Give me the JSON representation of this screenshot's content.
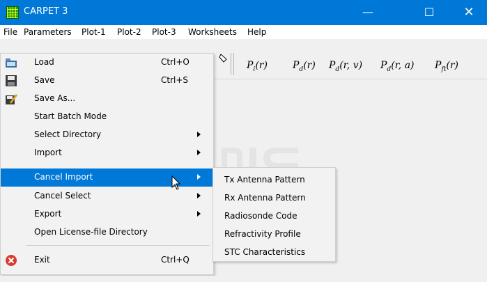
{
  "window": {
    "title": "CARPET 3",
    "minimize_glyph": "—",
    "maximize_glyph": "☐",
    "close_glyph": "✕"
  },
  "menubar": [
    "File",
    "Parameters",
    "Plot-1",
    "Plot-2",
    "Plot-3",
    "Worksheets",
    "Help"
  ],
  "toolbar": {
    "formulas": [
      {
        "base": "P",
        "sub": "i",
        "arg": "(r)"
      },
      {
        "base": "P",
        "sub": "d",
        "arg": "(r)"
      },
      {
        "base": "P",
        "sub": "d",
        "arg": "(r, v)"
      },
      {
        "base": "P",
        "sub": "d",
        "arg": "(r, a)"
      },
      {
        "base": "P",
        "sub": "ft",
        "arg": "(r)"
      }
    ]
  },
  "file_menu": {
    "items": [
      {
        "label": "Load",
        "shortcut": "Ctrl+O",
        "icon": "folder-open-icon"
      },
      {
        "label": "Save",
        "shortcut": "Ctrl+S",
        "icon": "floppy-disk-icon"
      },
      {
        "label": "Save As...",
        "shortcut": "",
        "icon": "save-as-pen-icon"
      },
      {
        "label": "Start Batch Mode",
        "shortcut": ""
      },
      {
        "label": "Select Directory",
        "shortcut": "",
        "submenu": true
      },
      {
        "label": "Import",
        "shortcut": "",
        "submenu": true
      },
      {
        "label": "Cancel Import",
        "shortcut": "",
        "submenu": true,
        "active": true
      },
      {
        "label": "Cancel Select",
        "shortcut": "",
        "submenu": true
      },
      {
        "label": "Export",
        "shortcut": "",
        "submenu": true
      },
      {
        "label": "Open License-file Directory",
        "shortcut": ""
      },
      {
        "label": "Exit",
        "shortcut": "Ctrl+Q",
        "icon": "exit-icon"
      }
    ]
  },
  "submenu": {
    "items": [
      "Tx Antenna Pattern",
      "Rx Antenna Pattern",
      "Radiosonde Code",
      "Refractivity Profile",
      "STC Characteristics"
    ]
  },
  "colors": {
    "titlebar": "#0078d7",
    "highlight": "#0078d7",
    "menu_bg": "#f2f2f2"
  }
}
